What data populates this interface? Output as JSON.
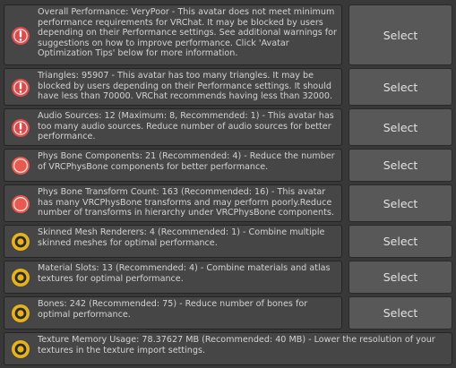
{
  "button_label": "Select",
  "colors": {
    "background": "#383838",
    "message_bg": "#464646",
    "button_bg": "#585858",
    "very_poor": "#d94c4c",
    "poor": "#e85a4f",
    "medium": "#e6b31e",
    "text": "#d2d2d2"
  },
  "items": [
    {
      "severity": "very-poor",
      "icon": "error-exclamation-icon",
      "text": "Overall Performance: VeryPoor - This avatar does not meet minimum performance requirements for VRChat. It may be blocked by users depending on their Performance settings. See additional warnings for suggestions on how to improve performance. Click 'Avatar Optimization Tips' below for more information.",
      "has_button": true
    },
    {
      "severity": "very-poor",
      "icon": "error-exclamation-icon",
      "text": "Triangles: 95907 - This avatar has too many triangles. It may be blocked by users depending on their Performance settings. It should have less than 70000. VRChat recommends having less than 32000.",
      "has_button": true
    },
    {
      "severity": "very-poor",
      "icon": "error-exclamation-icon",
      "text": "Audio Sources: 12 (Maximum: 8, Recommended: 1) - This avatar has too many audio sources. Reduce number of audio sources for better performance.",
      "has_button": true
    },
    {
      "severity": "poor",
      "icon": "poor-circle-icon",
      "text": "Phys Bone Components: 21 (Recommended: 4) - Reduce the number of VRCPhysBone components for better performance.",
      "has_button": true
    },
    {
      "severity": "poor",
      "icon": "poor-circle-icon",
      "text": "Phys Bone Transform Count: 163 (Recommended: 16) - This avatar has many VRCPhysBone transforms and may perform poorly.Reduce number of transforms in hierarchy under VRCPhysBone components.",
      "has_button": true
    },
    {
      "severity": "medium",
      "icon": "medium-ring-icon",
      "text": "Skinned Mesh Renderers: 4 (Recommended: 1) - Combine multiple skinned meshes for optimal performance.",
      "has_button": true
    },
    {
      "severity": "medium",
      "icon": "medium-ring-icon",
      "text": "Material Slots: 13 (Recommended: 4) - Combine materials and atlas textures for optimal performance.",
      "has_button": true
    },
    {
      "severity": "medium",
      "icon": "medium-ring-icon",
      "text": "Bones: 242 (Recommended: 75) - Reduce number of bones for optimal performance.",
      "has_button": true
    },
    {
      "severity": "medium",
      "icon": "medium-ring-icon",
      "text": "Texture Memory Usage: 78.37627 MB (Recommended: 40 MB) - Lower the resolution of your textures in the texture import settings.",
      "has_button": false
    }
  ]
}
